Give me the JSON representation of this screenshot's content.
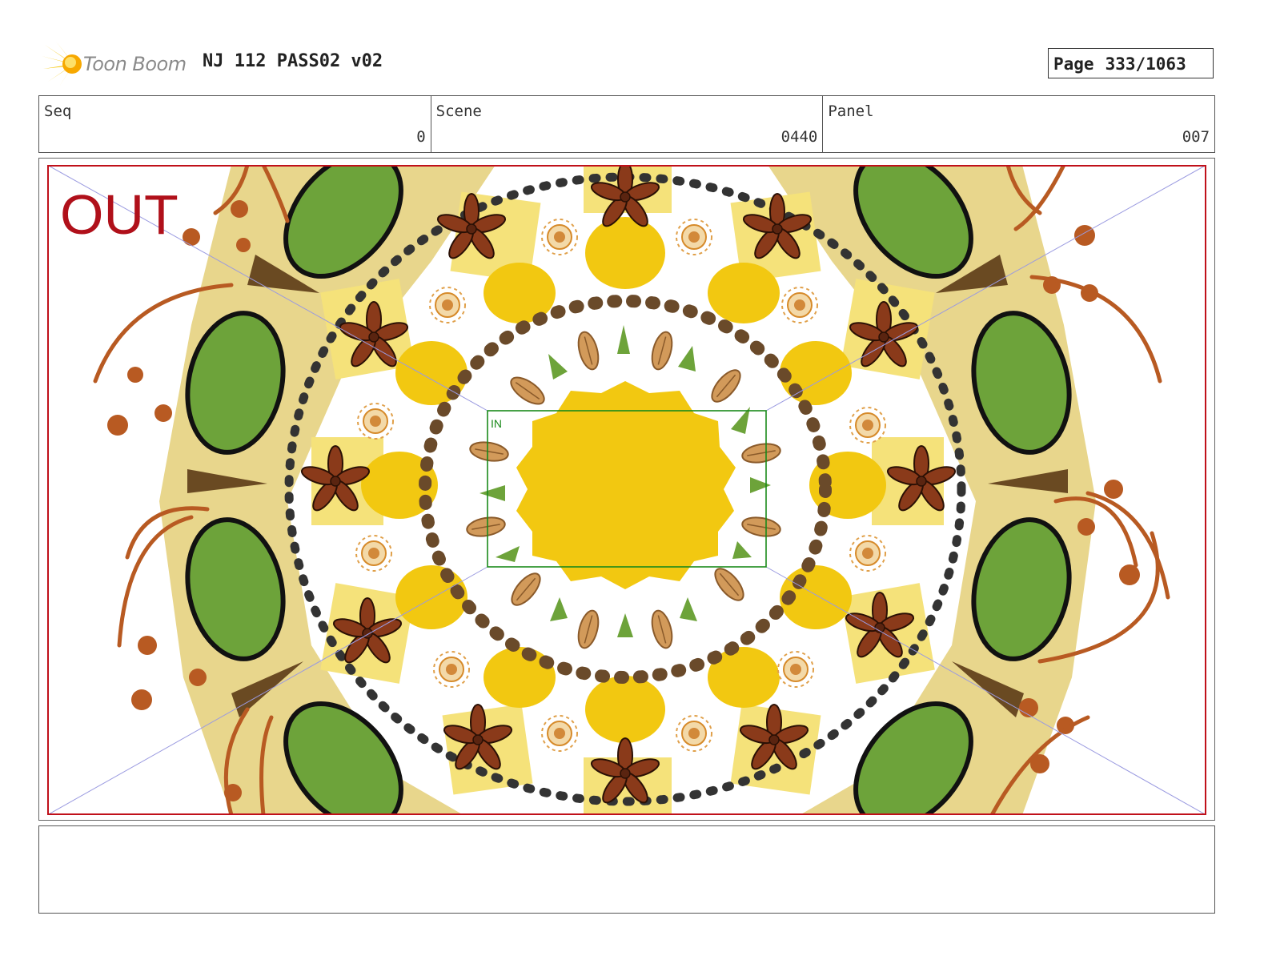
{
  "header": {
    "logo_text": "Toon Boom",
    "title": "NJ 112 PASS02 v02",
    "page_label": "Page",
    "page_value": "333/1063"
  },
  "info": {
    "seq_label": "Seq",
    "seq_value": "0",
    "scene_label": "Scene",
    "scene_value": "0440",
    "panel_label": "Panel",
    "panel_value": "007"
  },
  "panel": {
    "out_label": "OUT",
    "in_label": "IN"
  },
  "colors": {
    "frame_red": "#c0101a",
    "in_green": "#1a8a1a",
    "saffron": "#f2c811",
    "leaf_green": "#6da33a",
    "star_anise": "#8a3a1a",
    "cream": "#e8d68c"
  },
  "notes": ""
}
